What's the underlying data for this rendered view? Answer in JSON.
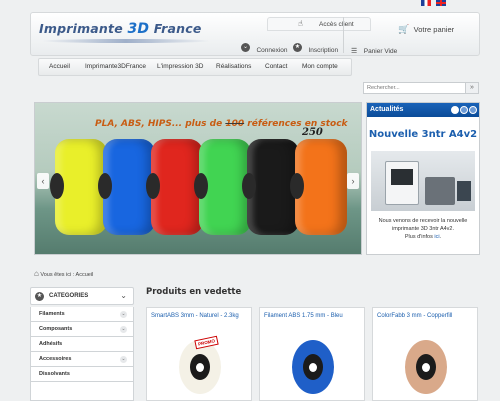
{
  "flags": {
    "fr": "Français",
    "en": "English"
  },
  "header": {
    "logo": {
      "part1": "Imprimante ",
      "part2": "3D",
      "part3": " France"
    },
    "account_title": "Accès client",
    "login": "Connexion",
    "register": "Inscription",
    "cart_title": "Votre panier",
    "cart_status": "Panier Vide"
  },
  "nav": {
    "items": [
      "Accueil",
      "Imprimante3DFrance",
      "L'impression 3D",
      "Réalisations",
      "Contact",
      "Mon compte"
    ]
  },
  "search": {
    "placeholder": "Rechercher..."
  },
  "slider": {
    "caption_start": "PLA, ABS, HIPS... plus de ",
    "caption_old": "100",
    "caption_new": "250",
    "caption_end": " références en stock",
    "spool_colors": [
      "#e9ef2a",
      "#1866e0",
      "#e0261e",
      "#41d452",
      "#1a1a1a",
      "#f3731a"
    ]
  },
  "news": {
    "title": "Actualités",
    "headline": "Nouvelle 3ntr A4v2",
    "text": "Nous venons de recevoir la nouvelle imprimante 3D 3ntr A4v2.",
    "more_prefix": "Plus d'infos ",
    "more_link": "ici",
    "more_suffix": "."
  },
  "breadcrumb": {
    "text": "Vous êtes ici : Accueil"
  },
  "sidebar": {
    "title": "CATEGORIES",
    "items": [
      {
        "label": "Filaments"
      },
      {
        "label": "Composants"
      },
      {
        "label": "Adhésifs"
      },
      {
        "label": "Accessoires"
      },
      {
        "label": "Dissolvants"
      }
    ]
  },
  "products": {
    "title": "Produits en vedette",
    "items": [
      {
        "name": "SmartABS 3mm - Naturel - 2.3kg",
        "color": "#f4f1e6",
        "badge": "PROMO"
      },
      {
        "name": "Filament ABS 1.75 mm - Bleu",
        "color": "#1f5fc8"
      },
      {
        "name": "ColorFabb 3 mm - Copperfill",
        "color": "#d9a98a"
      }
    ]
  },
  "colors": {
    "accent": "#1c5fae",
    "news_header": "#0b4c99",
    "slider_caption": "#c85c12"
  }
}
